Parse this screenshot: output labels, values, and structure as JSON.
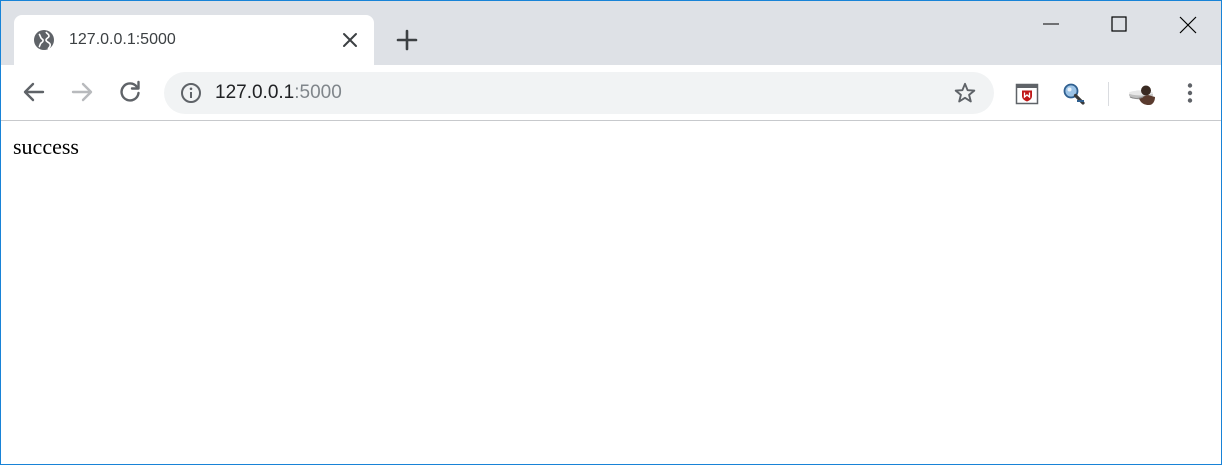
{
  "window": {
    "controls": {
      "minimize": "minimize-icon",
      "maximize": "maximize-icon",
      "close": "close-icon"
    }
  },
  "tab": {
    "title": "127.0.0.1:5000",
    "favicon": "globe-icon",
    "close": "close-icon"
  },
  "new_tab": "plus-icon",
  "toolbar": {
    "back": "arrow-left-icon",
    "forward": "arrow-right-icon",
    "reload": "reload-icon"
  },
  "omnibox": {
    "info_icon": "info-icon",
    "host": "127.0.0.1",
    "port": ":5000",
    "bookmark_icon": "star-icon"
  },
  "extensions": [
    "mcafee-shield-icon",
    "search-magnifier-icon"
  ],
  "profile": "avatar",
  "menu": "kebab-menu-icon",
  "page": {
    "text": "success"
  },
  "colors": {
    "window_border": "#1883d7",
    "tabstrip": "#dee1e6",
    "omnibox": "#f1f3f4",
    "icon": "#5f6368",
    "url_port": "#80868b",
    "mcafee_red": "#c01818"
  }
}
